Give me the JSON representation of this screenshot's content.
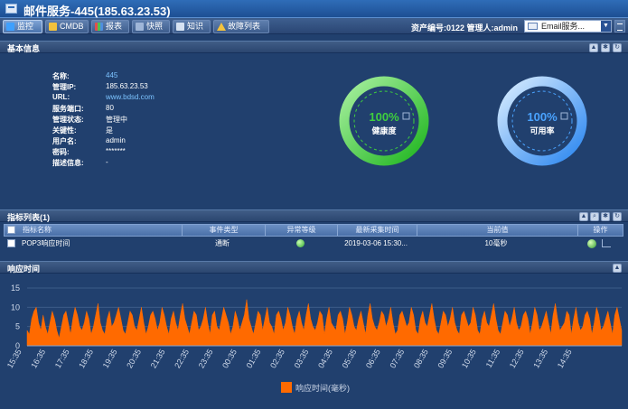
{
  "window": {
    "title": "邮件服务-445(185.63.23.53)"
  },
  "toolbar": {
    "tabs": [
      {
        "label": "监控",
        "icon": "monitor-icon",
        "active": true
      },
      {
        "label": "CMDB",
        "icon": "cmdb-icon",
        "active": false
      },
      {
        "label": "报表",
        "icon": "report-icon",
        "active": false
      },
      {
        "label": "快照",
        "icon": "snapshot-icon",
        "active": false
      },
      {
        "label": "知识",
        "icon": "knowledge-icon",
        "active": false
      },
      {
        "label": "故障列表",
        "icon": "warning-icon",
        "active": false
      }
    ],
    "asset_info": "资产编号:0122  管理人:admin",
    "service_select": "Email服务..."
  },
  "basic_info": {
    "title": "基本信息",
    "fields": [
      {
        "label": "名称:",
        "value": "445"
      },
      {
        "label": "管理IP:",
        "value": "185.63.23.53"
      },
      {
        "label": "URL:",
        "value": "www.bdsd.com"
      },
      {
        "label": "服务端口:",
        "value": "80"
      },
      {
        "label": "管理状态:",
        "value": "管理中"
      },
      {
        "label": "关键性:",
        "value": "是"
      },
      {
        "label": "用户名:",
        "value": "admin"
      },
      {
        "label": "密码:",
        "value": "*******"
      },
      {
        "label": "描述信息:",
        "value": "-"
      }
    ],
    "gauges": [
      {
        "value": "100%",
        "label": "健康度",
        "percent": 100,
        "color": "#3ecf3e"
      },
      {
        "value": "100%",
        "label": "可用率",
        "percent": 100,
        "color": "#4aa3ff"
      }
    ]
  },
  "metrics": {
    "title": "指标列表(1)",
    "headers": [
      "指标名称",
      "事件类型",
      "异常等级",
      "最新采集时间",
      "当前值",
      "操作"
    ],
    "rows": [
      {
        "name": "POP3响应时间",
        "event_type": "通断",
        "time": "2019-03-06 15:30...",
        "value": "10毫秒"
      }
    ]
  },
  "response": {
    "title": "响应时间",
    "legend": "响应时间(毫秒)"
  },
  "chart_data": {
    "type": "area",
    "ylim": [
      0,
      15
    ],
    "yticks": [
      0,
      5,
      10,
      15
    ],
    "xticks": [
      "15:35",
      "16:35",
      "17:35",
      "18:35",
      "19:35",
      "20:35",
      "21:35",
      "22:35",
      "23:35",
      "00:35",
      "01:35",
      "02:35",
      "03:35",
      "04:35",
      "05:35",
      "06:35",
      "07:35",
      "08:35",
      "09:35",
      "10:35",
      "11:35",
      "12:35",
      "13:35",
      "14:35"
    ],
    "series": [
      {
        "name": "响应时间(毫秒)",
        "color": "#ff6a00",
        "values": [
          4,
          3,
          7,
          9,
          10,
          6,
          4,
          8,
          5,
          3,
          6,
          9,
          7,
          4,
          2,
          5,
          8,
          9,
          6,
          3,
          7,
          10,
          8,
          5,
          4,
          6,
          9,
          7,
          3,
          5,
          8,
          11,
          6,
          4,
          3,
          7,
          9,
          5,
          6,
          8,
          10,
          7,
          4,
          3,
          6,
          9,
          8,
          5,
          4,
          7,
          10,
          6,
          3,
          5,
          8,
          9,
          7,
          4,
          6,
          10,
          8,
          5,
          3,
          7,
          9,
          6,
          4,
          8,
          11,
          7,
          5,
          3,
          6,
          9,
          8,
          4,
          5,
          7,
          10,
          6,
          3,
          8,
          9,
          5,
          4,
          7,
          10,
          8,
          6,
          3,
          5,
          9,
          7,
          4,
          6,
          8,
          12,
          7,
          5,
          3,
          6,
          9,
          8,
          4,
          7,
          10,
          6,
          5,
          3,
          8,
          9,
          7,
          4,
          6,
          10,
          8,
          5,
          3,
          7,
          9,
          6,
          4,
          8,
          11,
          7,
          5,
          4,
          6,
          9,
          8,
          3,
          7,
          10,
          6,
          5,
          4,
          8,
          9,
          7,
          3,
          6,
          10,
          8,
          5,
          4,
          7,
          9,
          6,
          3,
          8,
          11,
          7,
          5,
          4,
          6,
          9,
          8,
          5,
          7,
          10,
          6,
          3,
          4,
          8,
          9,
          7,
          5,
          6,
          10,
          8,
          4,
          3,
          7,
          9,
          6,
          5,
          8,
          11,
          7,
          4,
          3,
          6,
          9,
          8,
          5,
          7,
          10,
          6,
          4,
          3,
          8,
          9,
          7,
          5,
          6,
          10,
          8,
          4,
          3,
          7,
          9,
          6,
          5,
          8,
          11,
          7,
          4,
          3,
          6,
          9,
          8,
          5,
          7,
          10,
          6,
          4,
          5,
          8,
          9,
          7,
          3,
          6,
          10,
          8,
          4,
          5,
          7,
          9,
          6,
          3,
          8,
          11,
          7,
          4,
          5,
          6,
          9,
          8,
          3,
          7,
          10,
          6,
          4,
          5,
          8,
          9,
          7,
          3,
          6,
          10,
          8,
          4,
          5,
          7,
          9,
          6,
          3,
          8,
          10,
          7,
          4
        ]
      }
    ]
  }
}
